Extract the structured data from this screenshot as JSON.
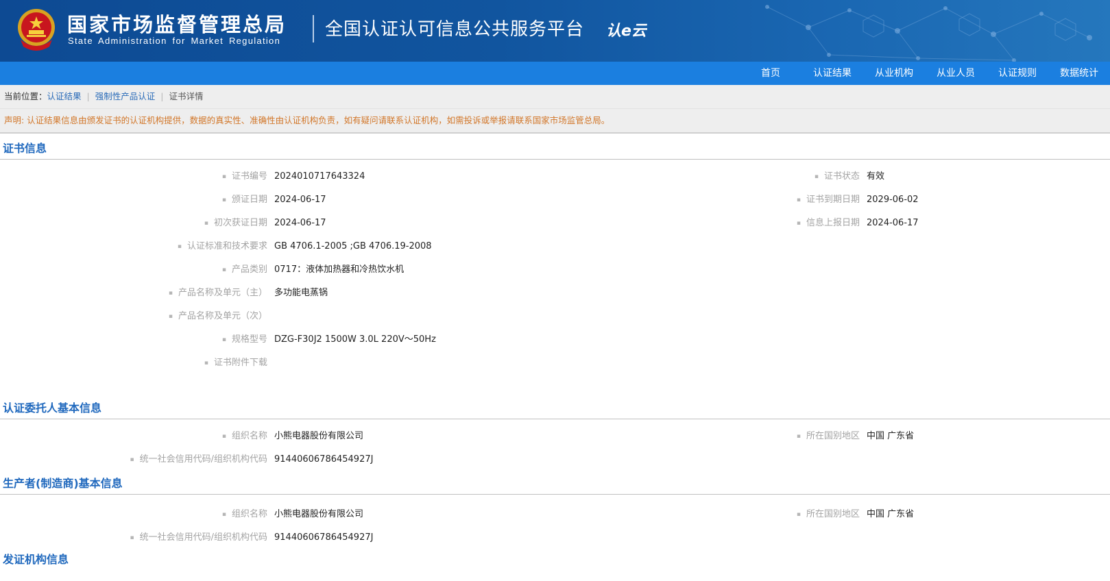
{
  "header": {
    "org_name_cn": "国家市场监督管理总局",
    "org_name_en": "State Administration  for  Market Regulation",
    "platform_title": "全国认证认可信息公共服务平台",
    "logo_text": "认e云"
  },
  "nav": {
    "items": [
      "首页",
      "认证结果",
      "从业机构",
      "从业人员",
      "认证规则",
      "数据统计"
    ]
  },
  "breadcrumb": {
    "prefix": "当前位置：",
    "item1": "认证结果",
    "item2": "强制性产品认证",
    "item3": "证书详情"
  },
  "notice": "声明: 认证结果信息由颁发证书的认证机构提供，数据的真实性、准确性由认证机构负责，如有疑问请联系认证机构，如需投诉或举报请联系国家市场监管总局。",
  "certificate": {
    "title": "证书信息",
    "rows": [
      {
        "label": "证书编号",
        "value": "2024010717643324"
      },
      {
        "label": "颁证日期",
        "value": "2024-06-17"
      },
      {
        "label": "初次获证日期",
        "value": "2024-06-17"
      },
      {
        "label": "认证标准和技术要求",
        "value": "GB 4706.1-2005 ;GB 4706.19-2008"
      },
      {
        "label": "产品类别",
        "value": "0717：液体加热器和冷热饮水机"
      },
      {
        "label": "产品名称及单元（主）",
        "value": "多功能电蒸锅"
      },
      {
        "label": "产品名称及单元（次）",
        "value": ""
      },
      {
        "label": "规格型号",
        "value": "DZG-F30J2 1500W 3.0L 220V～50Hz"
      },
      {
        "label": "证书附件下载",
        "value": ""
      }
    ],
    "right_rows": [
      {
        "label": "证书状态",
        "value": "有效"
      },
      {
        "label": "证书到期日期",
        "value": "2029-06-02"
      },
      {
        "label": "信息上报日期",
        "value": "2024-06-17"
      }
    ]
  },
  "client": {
    "title": "认证委托人基本信息",
    "org_label": "组织名称",
    "org_value": "小熊电器股份有限公司",
    "region_label": "所在国别地区",
    "region_value": "中国 广东省",
    "code_label": "统一社会信用代码/组织机构代码",
    "code_value": "91440606786454927J"
  },
  "manufacturer": {
    "title": "生产者(制造商)基本信息",
    "org_label": "组织名称",
    "org_value": "小熊电器股份有限公司",
    "region_label": "所在国别地区",
    "region_value": "中国 广东省",
    "code_label": "统一社会信用代码/组织机构代码",
    "code_value": "91440606786454927J"
  },
  "issuer": {
    "title": "发证机构信息"
  },
  "colors": {
    "banner": "#11559f",
    "navbar": "#1b7fe0",
    "section_title": "#1f68bd",
    "notice_text": "#d2772a"
  }
}
